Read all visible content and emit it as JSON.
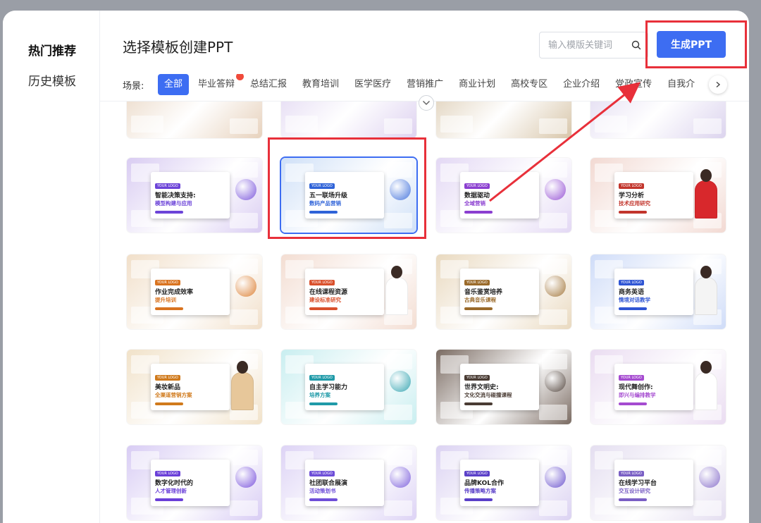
{
  "sidebar": {
    "items": [
      {
        "label": "热门推荐",
        "active": true
      },
      {
        "label": "历史模板",
        "active": false
      }
    ]
  },
  "header": {
    "title": "选择模板创建PPT",
    "search_placeholder": "输入模版关键词",
    "generate_label": "生成PPT"
  },
  "scene": {
    "label": "场景:",
    "categories": [
      {
        "label": "全部",
        "active": true,
        "hot": false
      },
      {
        "label": "毕业答辩",
        "active": false,
        "hot": true
      },
      {
        "label": "总结汇报",
        "active": false,
        "hot": false
      },
      {
        "label": "教育培训",
        "active": false,
        "hot": false
      },
      {
        "label": "医学医疗",
        "active": false,
        "hot": false
      },
      {
        "label": "营销推广",
        "active": false,
        "hot": false
      },
      {
        "label": "商业计划",
        "active": false,
        "hot": false
      },
      {
        "label": "高校专区",
        "active": false,
        "hot": false
      },
      {
        "label": "企业介绍",
        "active": false,
        "hot": false
      },
      {
        "label": "党政宣传",
        "active": false,
        "hot": false
      },
      {
        "label": "自我介",
        "active": false,
        "hot": false
      }
    ]
  },
  "colors": {
    "accent": "#3d6df2",
    "highlight": "#e8303a"
  },
  "templates": [
    {
      "title": "",
      "subtitle": "",
      "theme": "#e7d2bd",
      "accent": "#b07b4c",
      "partial": true
    },
    {
      "title": "",
      "subtitle": "",
      "theme": "#ded2f0",
      "accent": "#7b5ed6",
      "partial": true
    },
    {
      "title": "",
      "subtitle": "",
      "theme": "#d8c6aa",
      "accent": "#8a6238",
      "partial": true
    },
    {
      "title": "",
      "subtitle": "",
      "theme": "#dcd4ee",
      "accent": "#8a78c8",
      "partial": true
    },
    {
      "title": "智能决策支持:",
      "subtitle": "模型构建与应用",
      "theme": "#d9ccf2",
      "accent": "#6c44d8"
    },
    {
      "title": "五一联场升级",
      "subtitle": "数码产品营销",
      "theme": "#cfe0f7",
      "accent": "#2f63d8",
      "selected": true
    },
    {
      "title": "数据驱动",
      "subtitle": "全域营销",
      "theme": "#e3d8f4",
      "accent": "#8b3fd0"
    },
    {
      "title": "学习分析",
      "subtitle": "技术应用研究",
      "theme": "#f2d9d2",
      "accent": "#c2352c",
      "person": "#d8282c"
    },
    {
      "title": "作业完成效率",
      "subtitle": "提升培训",
      "theme": "#f1dfc9",
      "accent": "#d9731f"
    },
    {
      "title": "在线课程资源",
      "subtitle": "建设标准研究",
      "theme": "#f3ddd2",
      "accent": "#d9502c",
      "person": "#ffffff"
    },
    {
      "title": "音乐鉴赏培养",
      "subtitle": "古典音乐课程",
      "theme": "#e9d9bf",
      "accent": "#9a6a2a"
    },
    {
      "title": "商务英语",
      "subtitle": "情境对话教学",
      "theme": "#cfdcf8",
      "accent": "#2f55d4",
      "person": "#f4f4f4"
    },
    {
      "title": "美妆新品",
      "subtitle": "全渠道营销方案",
      "theme": "#f1e2c9",
      "accent": "#d07a1c",
      "person": "#e7c79a"
    },
    {
      "title": "自主学习能力",
      "subtitle": "培养方案",
      "theme": "#c9eef0",
      "accent": "#1f9aa8"
    },
    {
      "title": "世界文明史:",
      "subtitle": "文化交流与碰撞课程",
      "theme": "#7a6b62",
      "accent": "#4a3c34"
    },
    {
      "title": "现代舞创作:",
      "subtitle": "即兴与编排教学",
      "theme": "#eadcf1",
      "accent": "#a54bd0",
      "person": "#ffffff"
    },
    {
      "title": "数字化时代的",
      "subtitle": "人才管理创新",
      "theme": "#d8ccf4",
      "accent": "#6a3fd8"
    },
    {
      "title": "社团联合展演",
      "subtitle": "活动策划书",
      "theme": "#ddd3f5",
      "accent": "#6e4ed8"
    },
    {
      "title": "品牌KOL合作",
      "subtitle": "传播策略方案",
      "theme": "#dbd2f2",
      "accent": "#5a3fc8"
    },
    {
      "title": "在线学习平台",
      "subtitle": "交互设计研究",
      "theme": "#e4def0",
      "accent": "#7a5fc4"
    }
  ]
}
